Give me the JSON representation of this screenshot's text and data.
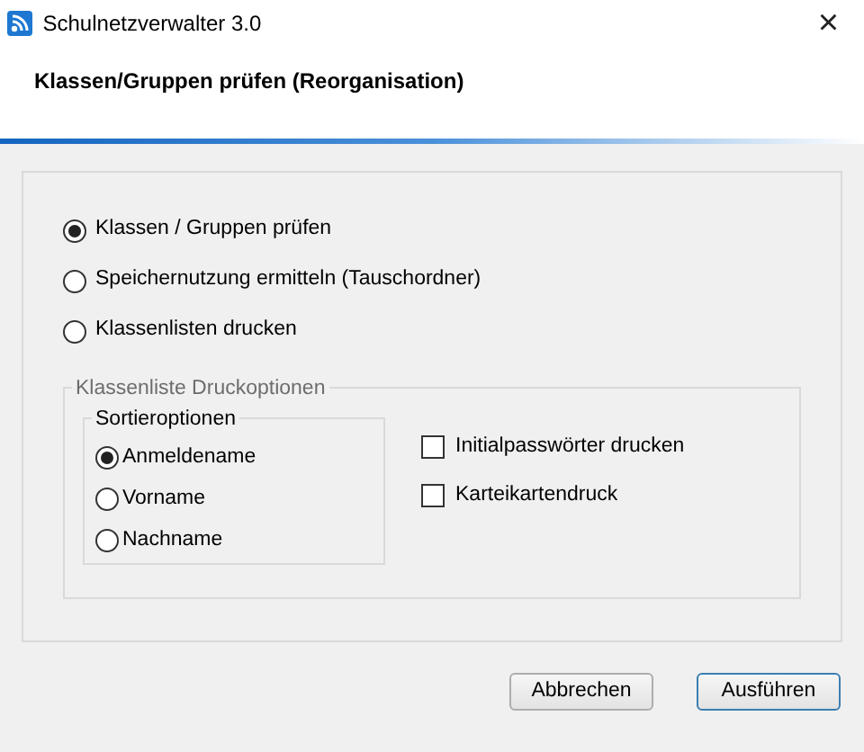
{
  "window": {
    "title": "Schulnetzverwalter 3.0",
    "close": "×"
  },
  "header": {
    "title": "Klassen/Gruppen prüfen (Reorganisation)"
  },
  "actions": [
    {
      "label": "Klassen / Gruppen prüfen",
      "selected": true
    },
    {
      "label": "Speichernutzung ermitteln (Tauschordner)",
      "selected": false
    },
    {
      "label": "Klassenlisten drucken",
      "selected": false
    }
  ],
  "print_options": {
    "title": "Klassenliste Druckoptionen",
    "sort": {
      "title": "Sortieroptionen",
      "options": [
        {
          "label": "Anmeldename",
          "selected": true
        },
        {
          "label": "Vorname",
          "selected": false
        },
        {
          "label": "Nachname",
          "selected": false
        }
      ]
    },
    "checkboxes": [
      {
        "label": "Initialpasswörter drucken",
        "checked": false
      },
      {
        "label": "Karteikartendruck",
        "checked": false
      }
    ]
  },
  "buttons": [
    {
      "label": "Abbrechen",
      "default": false
    },
    {
      "label": "Ausführen",
      "default": true
    }
  ]
}
